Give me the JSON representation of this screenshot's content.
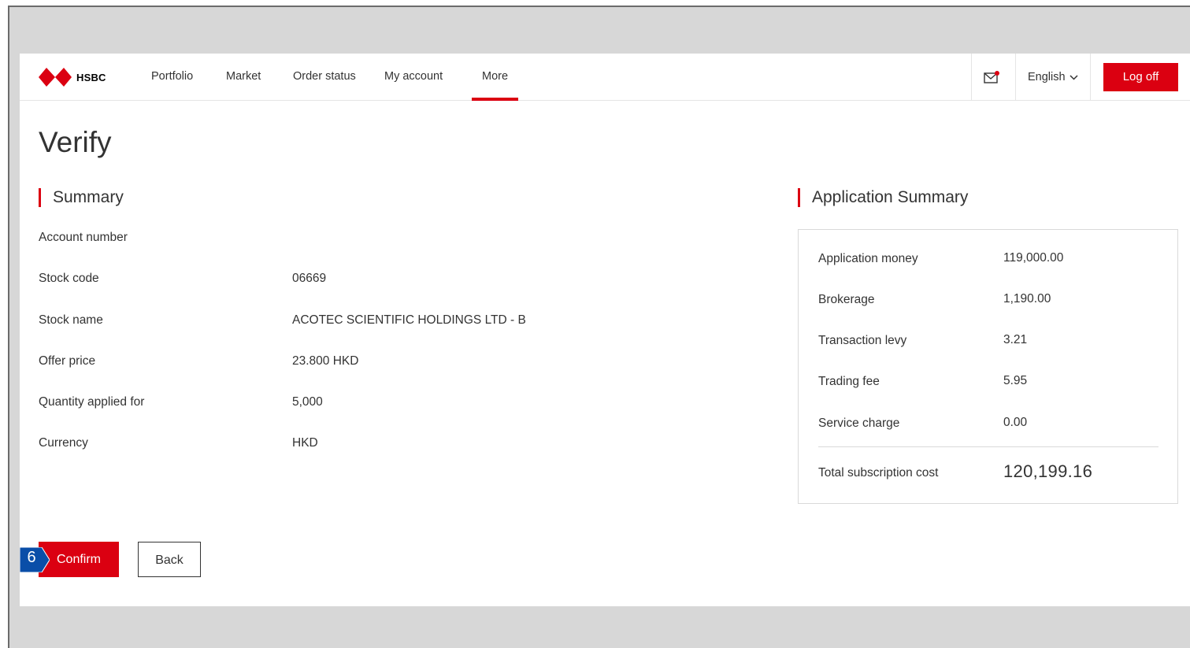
{
  "header": {
    "brand": "HSBC",
    "nav": [
      "Portfolio",
      "Market",
      "Order status",
      "My account",
      "More"
    ],
    "active_nav": "More",
    "language": "English",
    "logoff_label": "Log off"
  },
  "page_title": "Verify",
  "summary": {
    "title": "Summary",
    "rows": [
      {
        "label": "Account number",
        "value": ""
      },
      {
        "label": "Stock code",
        "value": "06669"
      },
      {
        "label": "Stock name",
        "value": "ACOTEC SCIENTIFIC HOLDINGS LTD - B"
      },
      {
        "label": "Offer price",
        "value": "23.800 HKD"
      },
      {
        "label": "Quantity applied for",
        "value": "5,000"
      },
      {
        "label": "Currency",
        "value": "HKD"
      }
    ]
  },
  "application_summary": {
    "title": "Application Summary",
    "rows": [
      {
        "label": "Application money",
        "value": "119,000.00"
      },
      {
        "label": "Brokerage",
        "value": "1,190.00"
      },
      {
        "label": "Transaction levy",
        "value": "3.21"
      },
      {
        "label": "Trading fee",
        "value": "5.95"
      },
      {
        "label": "Service charge",
        "value": "0.00"
      }
    ],
    "total_label": "Total subscription cost",
    "total_value": "120,199.16"
  },
  "actions": {
    "confirm_label": "Confirm",
    "back_label": "Back"
  },
  "step_marker": "6",
  "colors": {
    "brand_red": "#db0011",
    "step_blue": "#0a4ea8"
  }
}
